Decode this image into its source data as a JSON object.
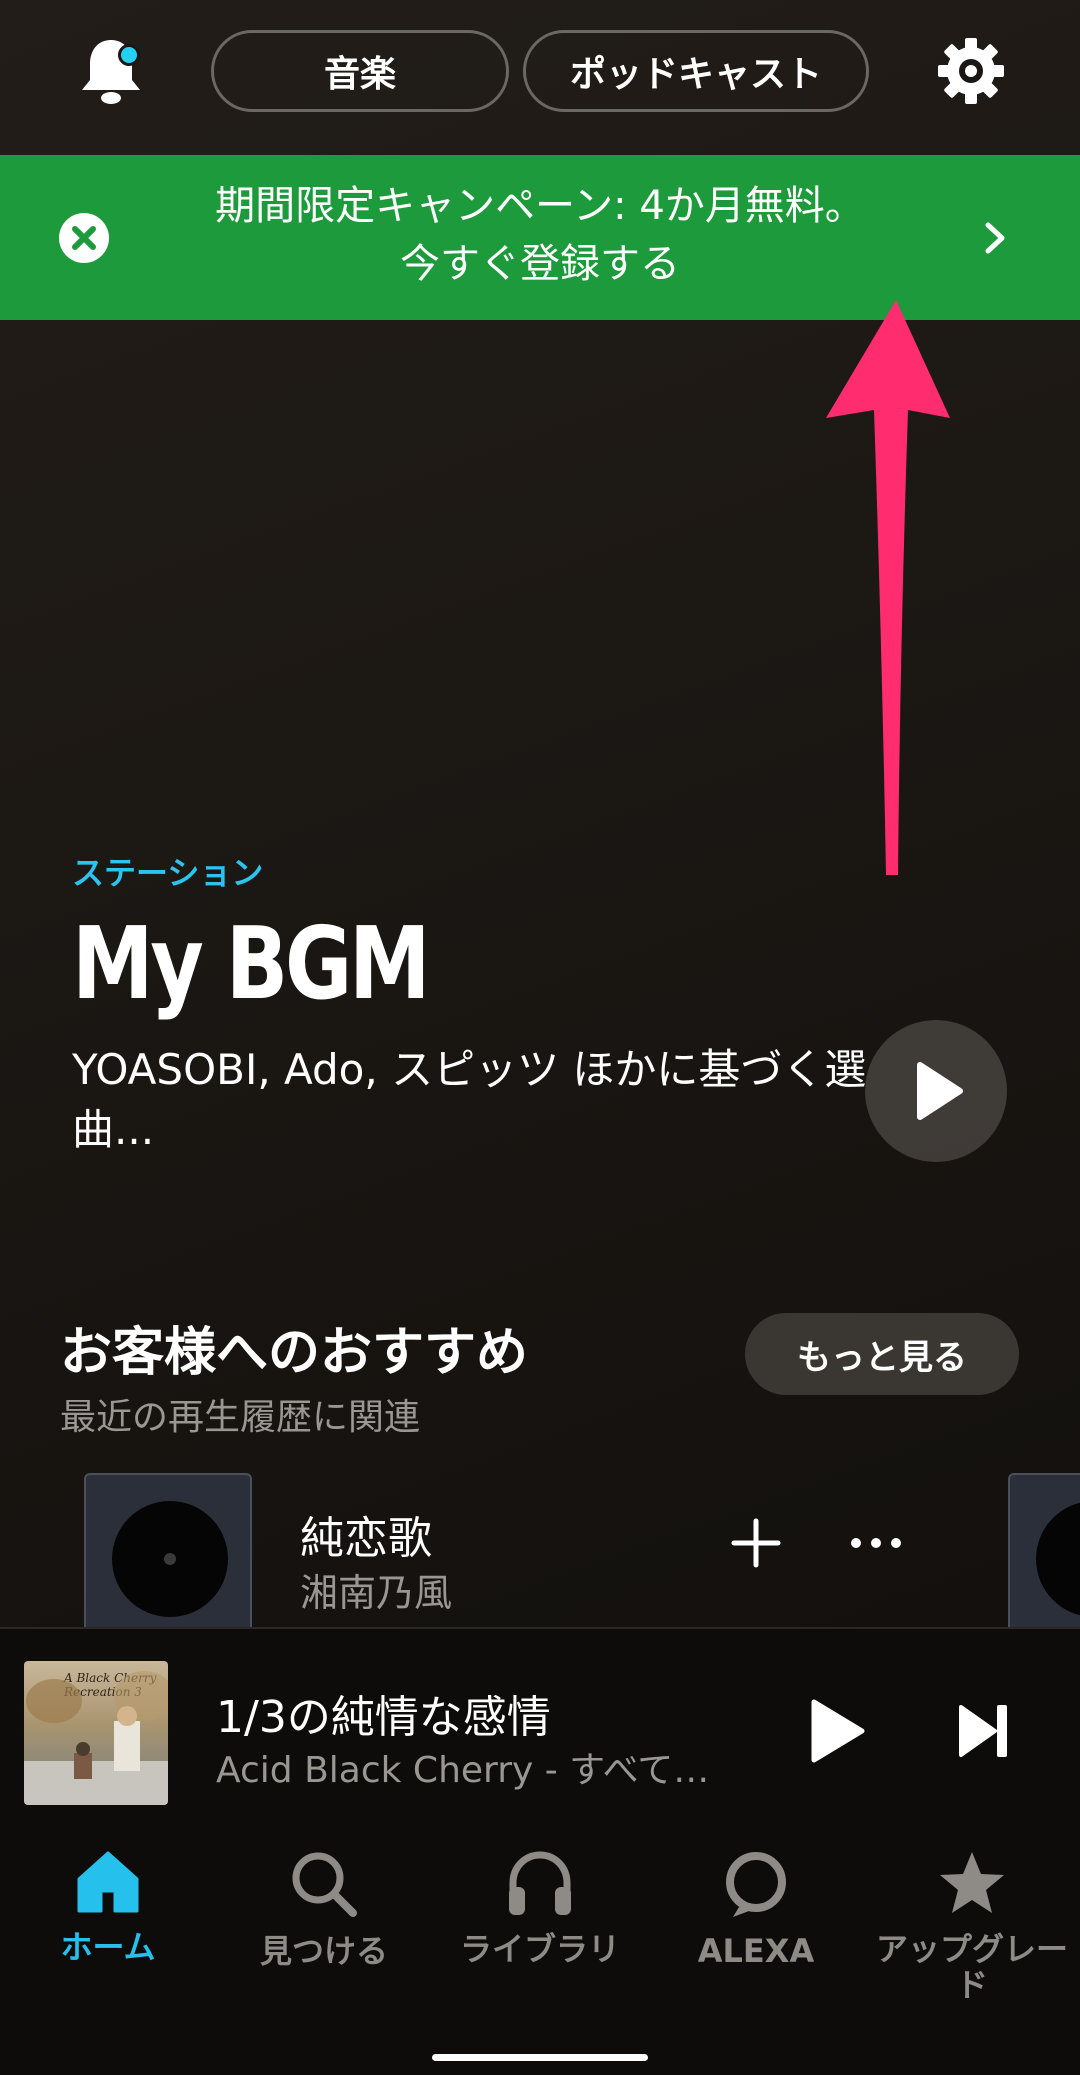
{
  "header": {
    "tabs": [
      {
        "label": "音楽"
      },
      {
        "label": "ポッドキャスト"
      }
    ]
  },
  "banner": {
    "line1": "期間限定キャンペーン: 4か月無料。",
    "line2": "今すぐ登録する"
  },
  "station": {
    "label": "ステーション",
    "title": "My BGM",
    "description": " YOASOBI, Ado, スピッツ ほかに基づく選曲..."
  },
  "recommendations": {
    "title": "お客様へのおすすめ",
    "subtitle": "最近の再生履歴に関連",
    "more_label": "もっと見る",
    "tracks": [
      {
        "title": "純恋歌",
        "artist": "湘南乃風"
      }
    ]
  },
  "now_playing": {
    "title": "1/3の純情な感情",
    "subtitle": "Acid Black Cherry - すべて…",
    "art_text": "A Black Cherry Recreation 3"
  },
  "nav": {
    "items": [
      {
        "label": "ホーム",
        "icon": "home-icon",
        "active": true
      },
      {
        "label": "見つける",
        "icon": "search-icon"
      },
      {
        "label": "ライブラリ",
        "icon": "headphones-icon"
      },
      {
        "label": "ALEXA",
        "icon": "alexa-icon"
      },
      {
        "label": "アップグレード",
        "icon": "star-icon"
      }
    ]
  },
  "colors": {
    "accent": "#25c0ec",
    "banner": "#1d9a3b",
    "annotation_arrow": "#ff2d6f"
  }
}
